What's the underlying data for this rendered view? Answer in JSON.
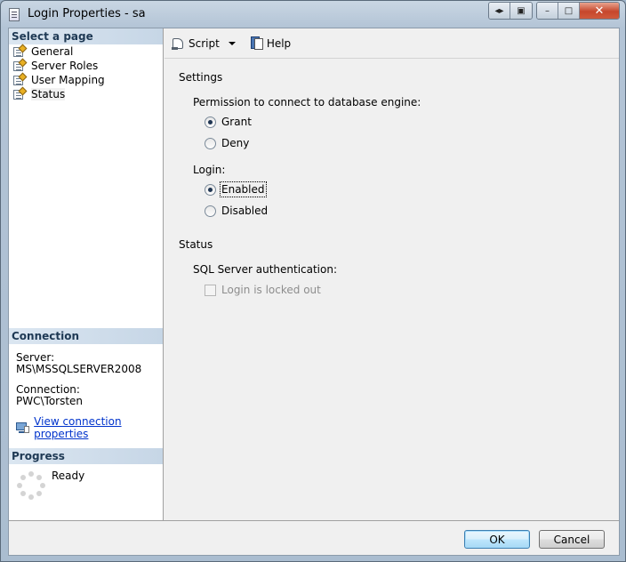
{
  "window": {
    "title": "Login Properties - sa"
  },
  "left": {
    "select_header": "Select a page",
    "pages": [
      {
        "label": "General"
      },
      {
        "label": "Server Roles"
      },
      {
        "label": "User Mapping"
      },
      {
        "label": "Status"
      }
    ],
    "connection_header": "Connection",
    "server_label": "Server:",
    "server_value": "MS\\MSSQLSERVER2008",
    "connection_label": "Connection:",
    "connection_value": "PWC\\Torsten",
    "view_link": "View connection properties",
    "progress_header": "Progress",
    "progress_status": "Ready"
  },
  "toolbar": {
    "script_label": "Script",
    "help_label": "Help"
  },
  "settings": {
    "title": "Settings",
    "permission_label": "Permission to connect to database engine:",
    "grant_label": "Grant",
    "deny_label": "Deny",
    "permission_value": "Grant",
    "login_label": "Login:",
    "enabled_label": "Enabled",
    "disabled_label": "Disabled",
    "login_value": "Enabled"
  },
  "status": {
    "title": "Status",
    "auth_label": "SQL Server authentication:",
    "locked_label": "Login is locked out",
    "locked_checked": false
  },
  "buttons": {
    "ok": "OK",
    "cancel": "Cancel"
  }
}
